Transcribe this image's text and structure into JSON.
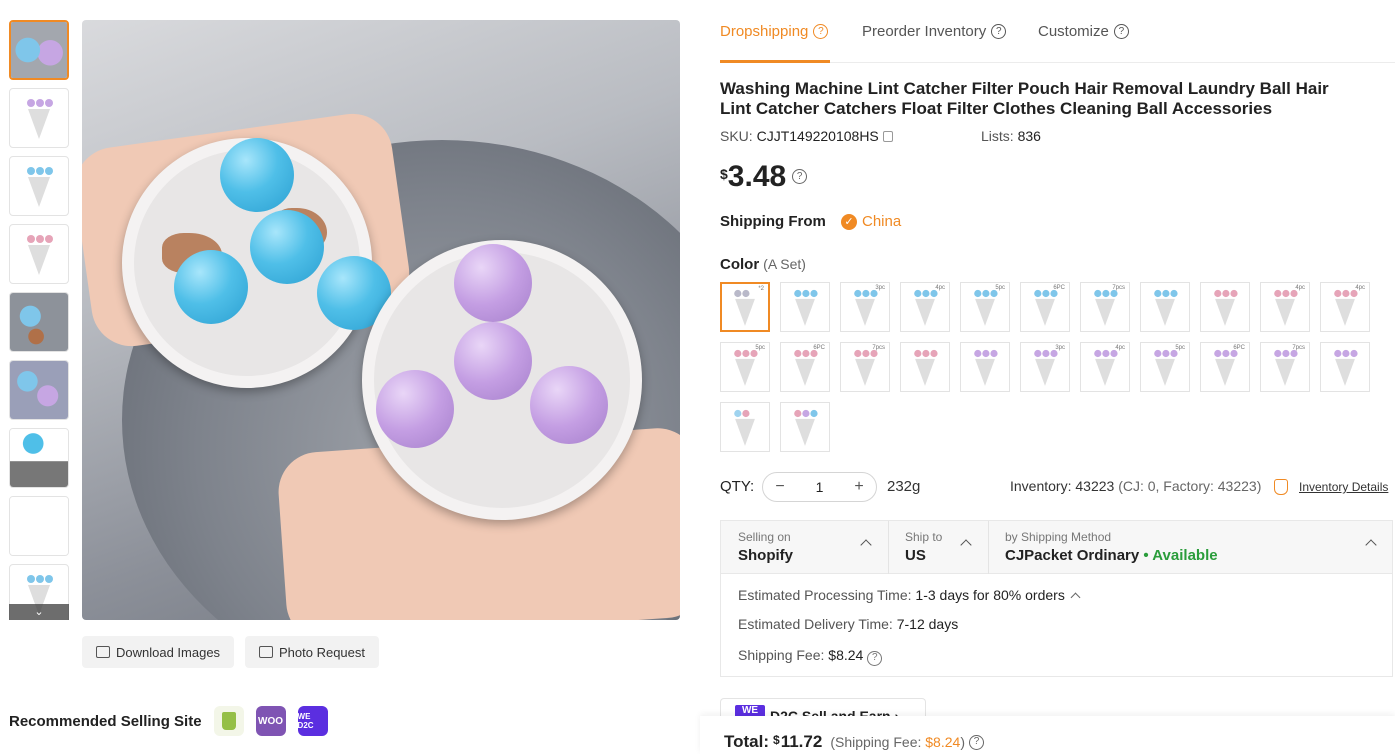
{
  "thumbnails": {
    "count": 9,
    "scroll_down_icon": "chevron-down-icon"
  },
  "image_actions": {
    "download_label": "Download Images",
    "photo_request_label": "Photo Request"
  },
  "recommended": {
    "label": "Recommended Selling Site",
    "sites": [
      {
        "name": "shopify-icon",
        "color": "#95bf47",
        "text": ""
      },
      {
        "name": "woocommerce-icon",
        "color": "#7f54b3",
        "text": "WOO"
      },
      {
        "name": "d2c-icon",
        "color": "#5b2ee0",
        "text": "WE D2C"
      }
    ]
  },
  "tabs": [
    {
      "label": "Dropshipping",
      "active": true
    },
    {
      "label": "Preorder Inventory",
      "active": false
    },
    {
      "label": "Customize",
      "active": false
    }
  ],
  "product": {
    "title": "Washing Machine Lint Catcher Filter Pouch Hair Removal Laundry Ball Hair Lint Catcher Catchers Float Filter Clothes Cleaning Ball Accessories",
    "sku_label": "SKU:",
    "sku": "CJJT149220108HS",
    "lists_label": "Lists:",
    "lists": "836",
    "currency": "$",
    "price": "3.48"
  },
  "shipping_from": {
    "label": "Shipping From",
    "value": "China"
  },
  "color": {
    "label": "Color",
    "selected": "(A Set)"
  },
  "swatches": [
    {
      "balls": [
        "#b9b9c9",
        "#b9b9c9"
      ],
      "tag": "*2"
    },
    {
      "balls": [
        "#7fc6ea",
        "#7fc6ea",
        "#7fc6ea"
      ],
      "tag": ""
    },
    {
      "balls": [
        "#7fc6ea",
        "#7fc6ea",
        "#7fc6ea"
      ],
      "tag": "3pc"
    },
    {
      "balls": [
        "#7fc6ea",
        "#7fc6ea",
        "#7fc6ea"
      ],
      "tag": "4pc"
    },
    {
      "balls": [
        "#7fc6ea",
        "#7fc6ea",
        "#7fc6ea"
      ],
      "tag": "5pc"
    },
    {
      "balls": [
        "#7fc6ea",
        "#7fc6ea",
        "#7fc6ea"
      ],
      "tag": "6PC"
    },
    {
      "balls": [
        "#7fc6ea",
        "#7fc6ea",
        "#7fc6ea"
      ],
      "tag": "7pcs"
    },
    {
      "balls": [
        "#7fc6ea",
        "#7fc6ea",
        "#7fc6ea"
      ],
      "tag": ""
    },
    {
      "balls": [
        "#e6a4b8",
        "#e6a4b8",
        "#e6a4b8"
      ],
      "tag": ""
    },
    {
      "balls": [
        "#e6a4b8",
        "#e6a4b8",
        "#e6a4b8"
      ],
      "tag": "4pc"
    },
    {
      "balls": [
        "#e6a4b8",
        "#e6a4b8",
        "#e6a4b8"
      ],
      "tag": "4pc"
    },
    {
      "balls": [
        "#e6a4b8",
        "#e6a4b8",
        "#e6a4b8"
      ],
      "tag": "5pc"
    },
    {
      "balls": [
        "#e6a4b8",
        "#e6a4b8",
        "#e6a4b8"
      ],
      "tag": "6PC"
    },
    {
      "balls": [
        "#e6a4b8",
        "#e6a4b8",
        "#e6a4b8"
      ],
      "tag": "7pcs"
    },
    {
      "balls": [
        "#e6a4b8",
        "#e6a4b8",
        "#e6a4b8"
      ],
      "tag": ""
    },
    {
      "balls": [
        "#c6a6e3",
        "#c6a6e3",
        "#c6a6e3"
      ],
      "tag": ""
    },
    {
      "balls": [
        "#c6a6e3",
        "#c6a6e3",
        "#c6a6e3"
      ],
      "tag": "3pc"
    },
    {
      "balls": [
        "#c6a6e3",
        "#c6a6e3",
        "#c6a6e3"
      ],
      "tag": "4pc"
    },
    {
      "balls": [
        "#c6a6e3",
        "#c6a6e3",
        "#c6a6e3"
      ],
      "tag": "5pc"
    },
    {
      "balls": [
        "#c6a6e3",
        "#c6a6e3",
        "#c6a6e3"
      ],
      "tag": "6PC"
    },
    {
      "balls": [
        "#c6a6e3",
        "#c6a6e3",
        "#c6a6e3"
      ],
      "tag": "7pcs"
    },
    {
      "balls": [
        "#c6a6e3",
        "#c6a6e3",
        "#c6a6e3"
      ],
      "tag": ""
    },
    {
      "balls": [
        "#9fd3ef",
        "#e6a4b8"
      ],
      "tag": ""
    },
    {
      "balls": [
        "#e6a4b8",
        "#c6a6e3",
        "#7fc6ea"
      ],
      "tag": ""
    }
  ],
  "quantity": {
    "label": "QTY:",
    "value": "1",
    "minus": "−",
    "plus": "+",
    "weight": "232g"
  },
  "inventory": {
    "text": "Inventory: 43223",
    "breakdown": "(CJ: 0, Factory: 43223)",
    "details_link": "Inventory Details"
  },
  "shipping": {
    "selling_on_label": "Selling on",
    "selling_on": "Shopify",
    "ship_to_label": "Ship to",
    "ship_to": "US",
    "method_label": "by Shipping Method",
    "method": "CJPacket Ordinary",
    "availability": "• Available",
    "processing_label": "Estimated Processing Time:",
    "processing": "1-3 days for 80% orders",
    "delivery_label": "Estimated Delivery Time:",
    "delivery": "7-12 days",
    "fee_label": "Shipping Fee:",
    "fee": "$8.24"
  },
  "promo": {
    "logo": "WE",
    "text": "D2C  Sell and Earn  ›"
  },
  "total": {
    "label": "Total:",
    "currency": "$",
    "amount": "11.72",
    "fee_prefix": "(Shipping Fee:",
    "fee": "$8.24",
    "fee_suffix": ")"
  },
  "colors": {
    "accent": "#f08a24",
    "available": "#2a9d3b"
  }
}
